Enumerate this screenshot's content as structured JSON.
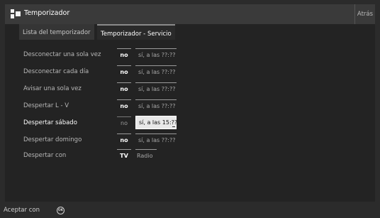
{
  "header": {
    "title": "Temporizador",
    "back_label": "Atrás"
  },
  "tabs": [
    {
      "label": "Lista del temporizador",
      "active": false
    },
    {
      "label": "Temporizador - Servicio",
      "active": true
    }
  ],
  "rows": [
    {
      "label": "Desconectar una sola vez",
      "no": "no",
      "si": "sí, a las ??:??"
    },
    {
      "label": "Desconectar cada día",
      "no": "no",
      "si": "sí, a las ??:??"
    },
    {
      "label": "Avisar una sola vez",
      "no": "no",
      "si": "sí, a las ??:??"
    },
    {
      "label": "Despertar L - V",
      "no": "no",
      "si": "sí, a las ??:??"
    },
    {
      "label": "Despertar sábado",
      "no": "no",
      "si": "sí, a las 15:??",
      "selected": "si"
    },
    {
      "label": "Despertar domingo",
      "no": "no",
      "si": "sí, a las ??:??"
    },
    {
      "label": "Despertar con",
      "tv": "TV",
      "radio": "Radio"
    }
  ],
  "footer": {
    "accept_label": "Aceptar con",
    "ok_icon_text": "OK"
  },
  "colors": {
    "background": "#232323",
    "header": "#3a3a3a",
    "selected_option": "#e8e8e8"
  },
  "icons": {
    "logo": "tv-logo-icon",
    "ok": "ok-button-icon"
  }
}
